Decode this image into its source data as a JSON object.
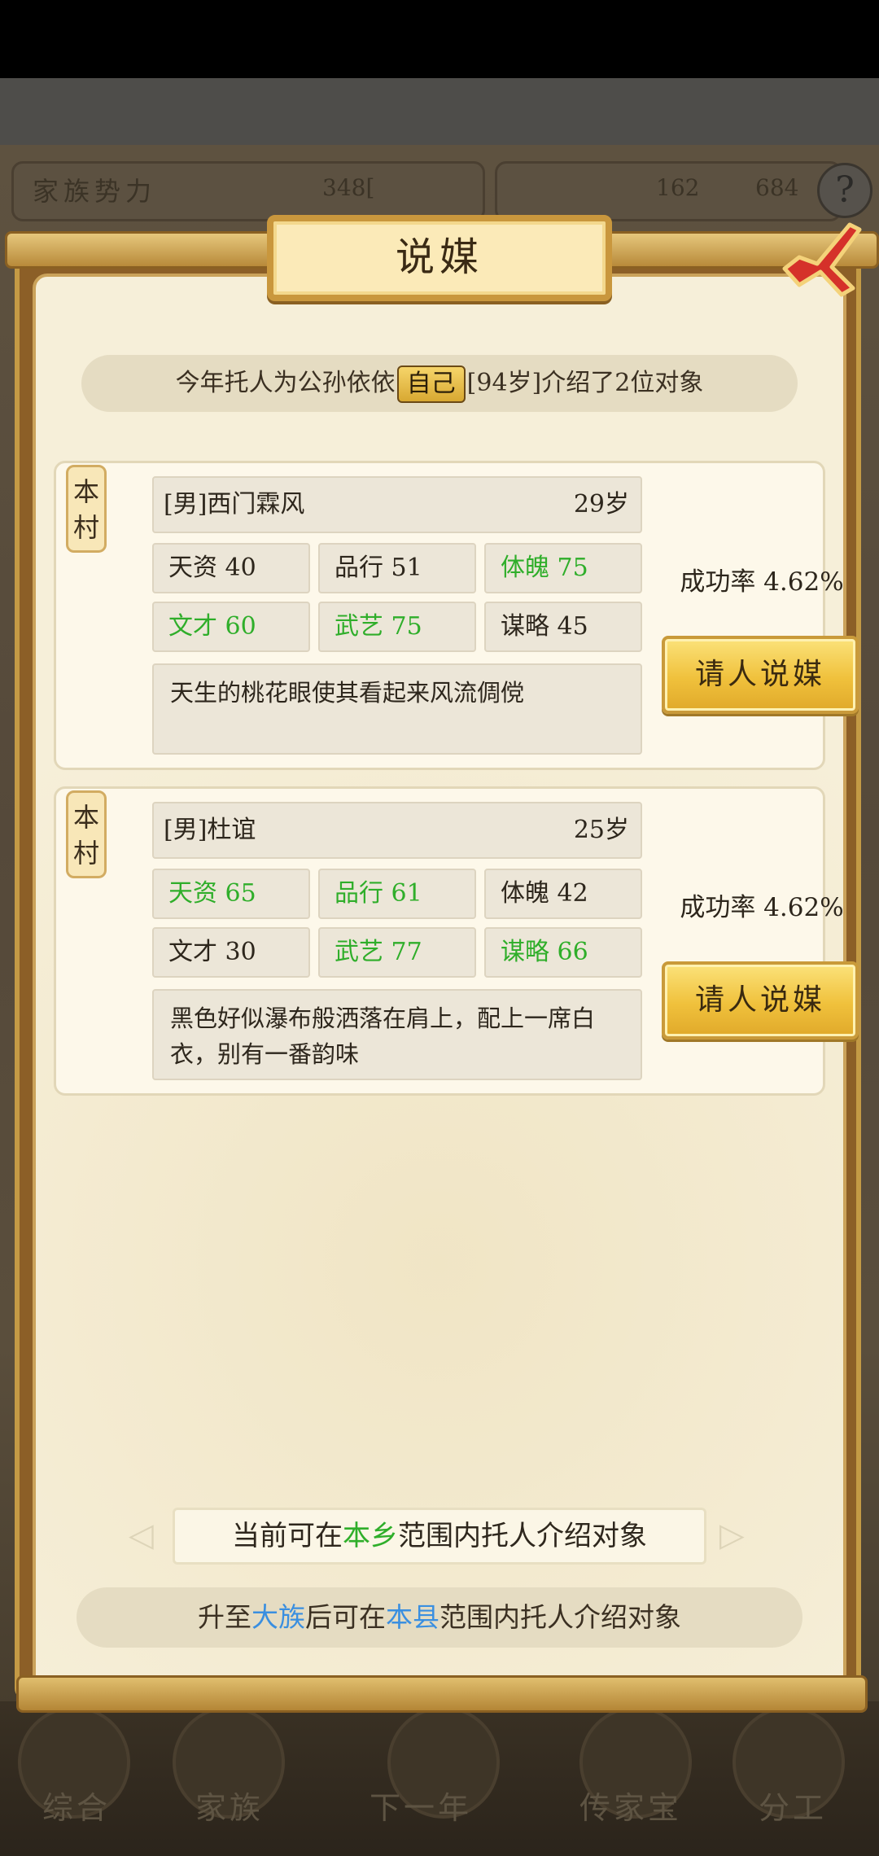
{
  "background": {
    "power_label": "家族势力",
    "power_value": "348[",
    "resource_a": "162",
    "resource_b": "684",
    "help_label": "?",
    "nav": [
      "综合",
      "家族",
      "下一年",
      "传家宝",
      "分工"
    ]
  },
  "dialog": {
    "title": "说媒",
    "intro": {
      "before": "今年托人为公孙依依",
      "self_badge": "自己",
      "after": "[94岁]介绍了2位对象"
    },
    "candidates": [
      {
        "tag": "本村",
        "name": "[男]西门霖风",
        "age": "29岁",
        "stats": [
          {
            "label": "天资 40",
            "highlight": false
          },
          {
            "label": "品行 51",
            "highlight": false
          },
          {
            "label": "体魄 75",
            "highlight": true
          },
          {
            "label": "文才 60",
            "highlight": true
          },
          {
            "label": "武艺 75",
            "highlight": true
          },
          {
            "label": "谋略 45",
            "highlight": false
          }
        ],
        "description": "天生的桃花眼使其看起来风流倜傥",
        "success_rate": "成功率 4.62%",
        "button": "请人说媒"
      },
      {
        "tag": "本村",
        "name": "[男]杜谊",
        "age": "25岁",
        "stats": [
          {
            "label": "天资 65",
            "highlight": true
          },
          {
            "label": "品行 61",
            "highlight": true
          },
          {
            "label": "体魄 42",
            "highlight": false
          },
          {
            "label": "文才 30",
            "highlight": false
          },
          {
            "label": "武艺 77",
            "highlight": true
          },
          {
            "label": "谋略 66",
            "highlight": true
          }
        ],
        "description": "黑色好似瀑布般洒落在肩上，配上一席白衣，别有一番韵味",
        "success_rate": "成功率 4.62%",
        "button": "请人说媒"
      }
    ],
    "scope_note": {
      "before": "当前可在",
      "highlight": "本乡",
      "after": "范围内托人介绍对象"
    },
    "upgrade_note": {
      "p1": "升至",
      "h1": "大族",
      "p2": "后可在",
      "h2": "本县",
      "p3": "范围内托人介绍对象"
    }
  },
  "colors": {
    "highlight_green": "#2fae2a",
    "highlight_blue": "#3a8fe0",
    "gold": "#f0c13c"
  }
}
